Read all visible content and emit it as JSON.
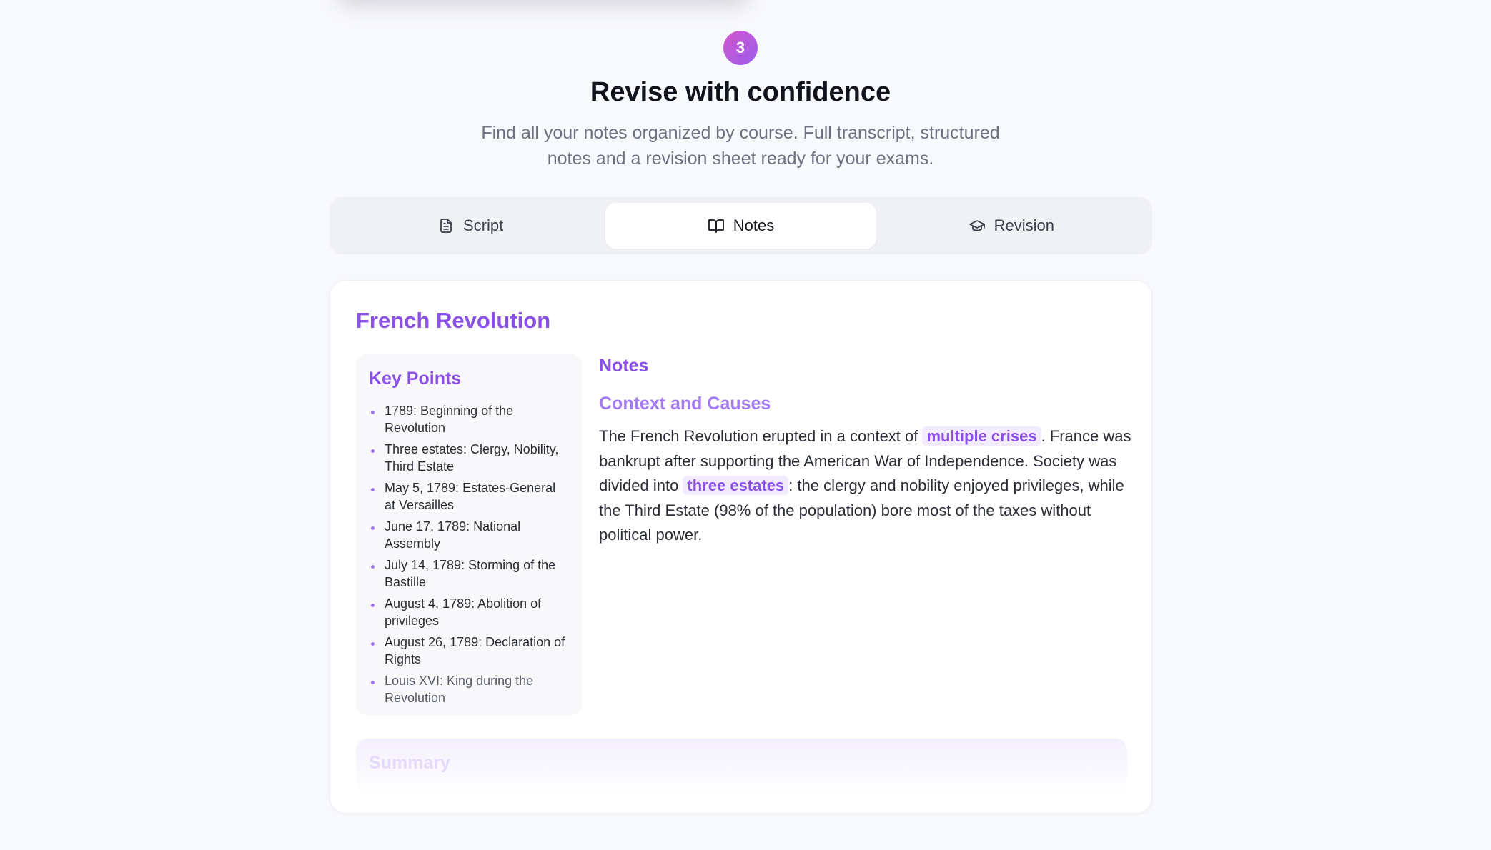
{
  "step": {
    "number": "3"
  },
  "header": {
    "title": "Revise with confidence",
    "subtitle_line1": "Find all your notes organized by course. Full transcript, structured",
    "subtitle_line2": "notes and a revision sheet ready for your exams."
  },
  "tabs": [
    {
      "label": "Script",
      "icon": "document-icon",
      "active": false
    },
    {
      "label": "Notes",
      "icon": "book-open-icon",
      "active": true
    },
    {
      "label": "Revision",
      "icon": "graduation-cap-icon",
      "active": false
    }
  ],
  "course": {
    "title": "French Revolution"
  },
  "key_points": {
    "title": "Key Points",
    "items": [
      "1789: Beginning of the Revolution",
      "Three estates: Clergy, Nobility, Third Estate",
      "May 5, 1789: Estates-General at Versailles",
      "June 17, 1789: National Assembly",
      "July 14, 1789: Storming of the Bastille",
      "August 4, 1789: Abolition of privileges",
      "August 26, 1789: Declaration of Rights",
      "Louis XVI: King during the Revolution"
    ]
  },
  "notes": {
    "title": "Notes",
    "section_title": "Context and Causes",
    "text_part1": "The French Revolution erupted in a context of ",
    "highlight1": "multiple crises",
    "text_part2": ". France was bankrupt after supporting the American War of Independence. Society was divided into ",
    "highlight2": "three estates",
    "text_part3": ": the clergy and nobility enjoyed privileges, while the Third Estate (98% of the population) bore most of the taxes without political power."
  },
  "summary": {
    "title": "Summary"
  },
  "colors": {
    "accent": "#8b50e6",
    "badge_gradient_start": "#d257c8",
    "badge_gradient_end": "#9b5cf0",
    "highlight_bg": "#f3ecfe"
  }
}
